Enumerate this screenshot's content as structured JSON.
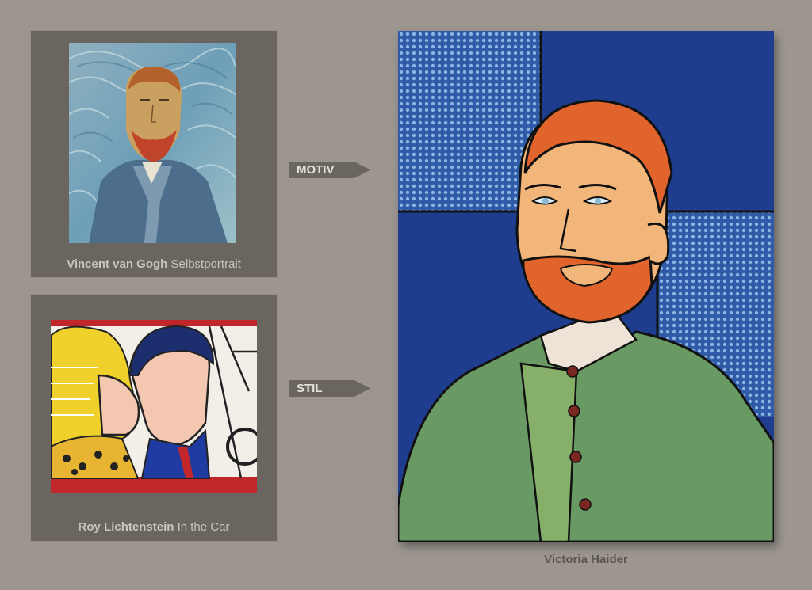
{
  "references": [
    {
      "artist": "Vincent van Gogh",
      "work": "Selbstportrait",
      "tag": "MOTIV",
      "image": "van-gogh-self-portrait"
    },
    {
      "artist": "Roy Lichtenstein",
      "work": "In the Car",
      "tag": "STIL",
      "image": "lichtenstein-in-the-car"
    }
  ],
  "result": {
    "artist": "Victoria Haider",
    "image": "pop-art-van-gogh-portrait"
  },
  "colors": {
    "background": "#9c9590",
    "panel": "#6b6560",
    "caption": "#c9c4bf"
  }
}
